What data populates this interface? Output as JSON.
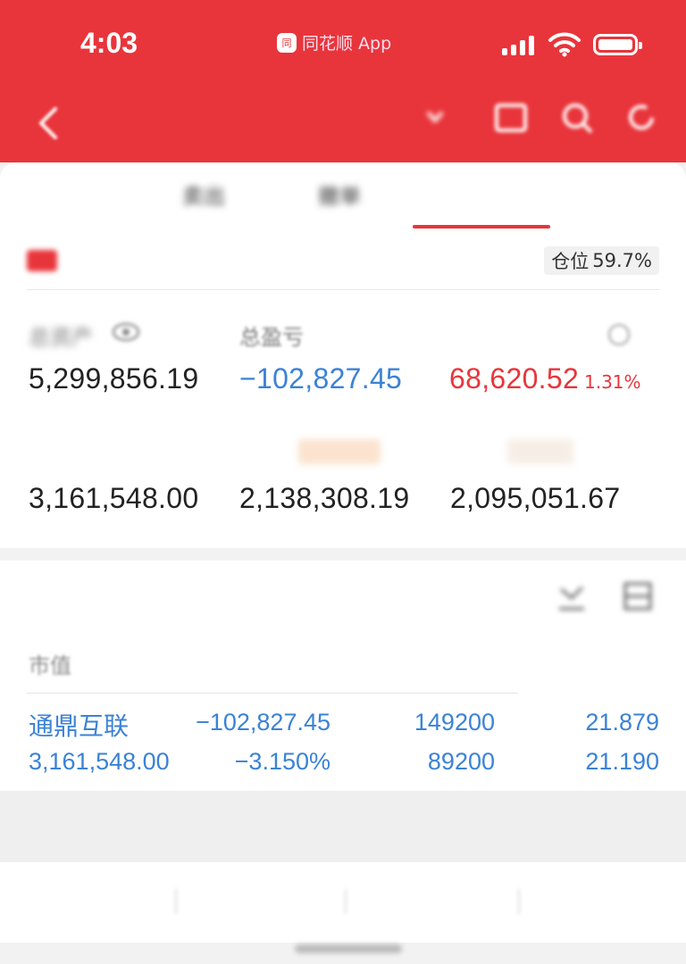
{
  "status_bar": {
    "time": "4:03",
    "carrier_logo": "同",
    "carrier_label": "同花顺 App",
    "signal_bars": 4,
    "battery_level": 1.0
  },
  "nav": {
    "title": "",
    "back_icon": "chevron-left-icon",
    "icons": [
      "message-icon",
      "search-icon",
      "refresh-icon"
    ]
  },
  "tabs": [
    {
      "label": "",
      "active": false
    },
    {
      "label": "卖出",
      "active": false
    },
    {
      "label": "撤单",
      "active": false
    },
    {
      "label": "",
      "active": true
    },
    {
      "label": "",
      "active": false
    }
  ],
  "account": {
    "label": "",
    "position_label": "仓位",
    "position_value": "59.7%"
  },
  "metrics": {
    "total_assets_label": "总资产",
    "total_assets": "5,299,856.19",
    "total_pnl_label": "总盈亏",
    "total_pnl": "−102,827.45",
    "today_pnl_label": "",
    "today_pnl": "68,620.52",
    "today_pnl_pct": "1.31%",
    "market_value_label": "",
    "market_value": "3,161,548.00",
    "available_label": "",
    "available": "2,138,308.19",
    "withdrawable_label": "",
    "withdrawable": "2,095,051.67"
  },
  "holdings": {
    "title": "",
    "columns": [
      "市值",
      "",
      "",
      ""
    ],
    "rows": [
      {
        "name": "通鼎互联",
        "market_value": "3,161,548.00",
        "pnl": "−102,827.45",
        "pnl_pct": "−3.150%",
        "shares": "149200",
        "available_shares": "89200",
        "cost": "21.879",
        "price": "21.190"
      }
    ]
  },
  "history_link": "",
  "actions": [
    "",
    "",
    "",
    ""
  ],
  "colors": {
    "brand_red": "#e8353b",
    "loss_blue": "#3b82d6"
  }
}
